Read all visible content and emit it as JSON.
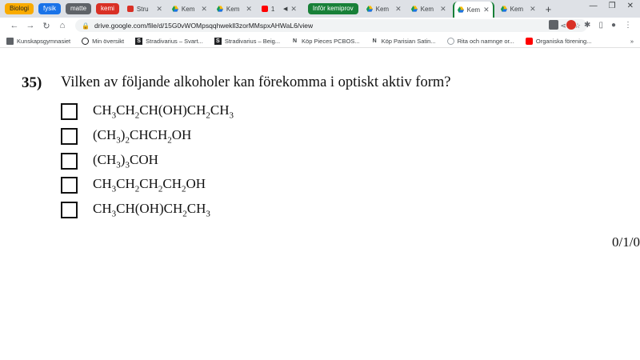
{
  "tabs": {
    "groups": [
      {
        "label": "Biologi",
        "color": "#f9ab00",
        "text": "#202124"
      },
      {
        "label": "fysik",
        "color": "#1a73e8",
        "text": "#ffffff"
      },
      {
        "label": "matte",
        "color": "#5f6368",
        "text": "#ffffff"
      },
      {
        "label": "kemi",
        "color": "#d93025",
        "text": "#ffffff"
      }
    ],
    "items": [
      {
        "title": "Stru",
        "icon": "book-icon"
      },
      {
        "title": "Kem",
        "icon": "drive-icon"
      },
      {
        "title": "Kem",
        "icon": "drive-icon"
      },
      {
        "title": "1",
        "icon": "youtube-icon"
      }
    ],
    "group2": {
      "label": "Inför kemiprov",
      "color": "#188038",
      "text": "#ffffff"
    },
    "items2": [
      {
        "title": "Kem",
        "icon": "drive-icon"
      },
      {
        "title": "Kem",
        "icon": "drive-icon"
      },
      {
        "title": "Kem",
        "icon": "drive-icon",
        "active": true
      },
      {
        "title": "Kem",
        "icon": "drive-icon"
      }
    ]
  },
  "address": {
    "url": "drive.google.com/file/d/15G0vWOMpsqqhwekll3zorMMspxAHWaL6/view"
  },
  "bookmarks": [
    {
      "label": "Kunskapsgymnasiet",
      "icon": "folder-icon"
    },
    {
      "label": "Min översikt",
      "icon": "site-icon"
    },
    {
      "label": "Stradivarius – Svart...",
      "icon": "stradivarius-icon"
    },
    {
      "label": "Stradivarius – Beig...",
      "icon": "stradivarius-icon"
    },
    {
      "label": "Köp Pieces PCBOS...",
      "icon": "n-icon"
    },
    {
      "label": "Köp Parisian Satin...",
      "icon": "n-icon"
    },
    {
      "label": "Rita och namnge or...",
      "icon": "globe-icon"
    },
    {
      "label": "Organiska förening...",
      "icon": "youtube-icon"
    }
  ],
  "question": {
    "number": "35)",
    "text": "Vilken av följande alkoholer kan förekomma i optiskt aktiv form?",
    "score": "0/1/0"
  },
  "options": [
    {
      "formula": "CH3CH2CH(OH)CH2CH3"
    },
    {
      "formula": "(CH3)2CHCH2OH"
    },
    {
      "formula": "(CH3)3COH"
    },
    {
      "formula": "CH3CH2CH2CH2OH"
    },
    {
      "formula": "CH3CH(OH)CH2CH3"
    }
  ]
}
